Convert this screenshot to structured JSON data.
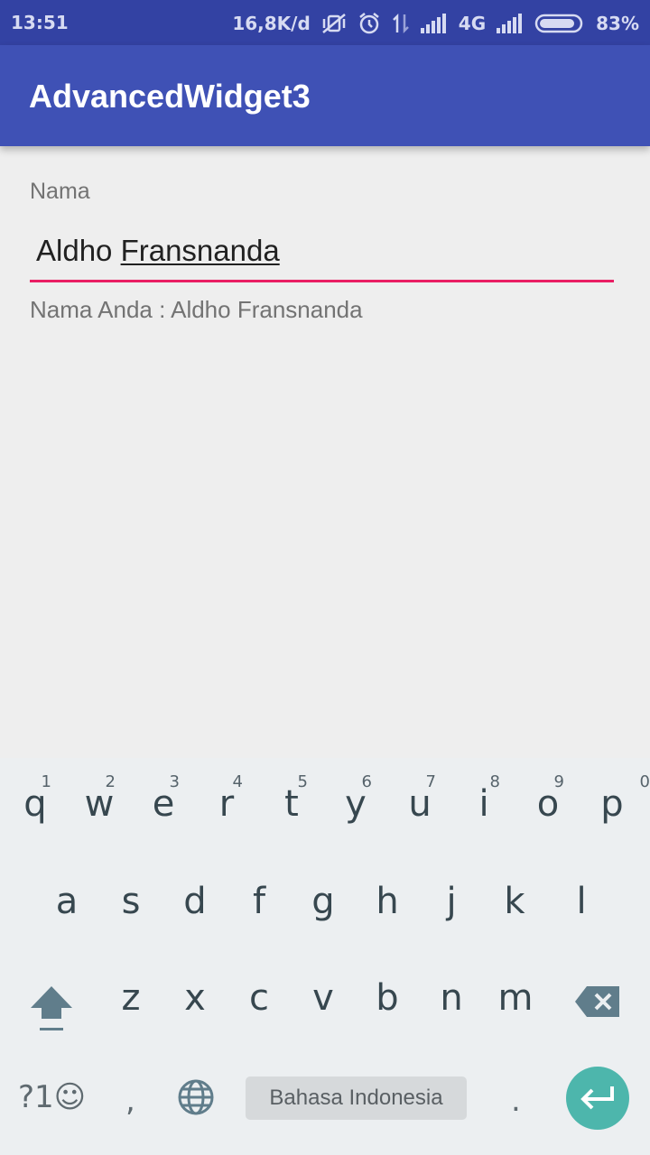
{
  "status_bar": {
    "time": "13:51",
    "speed": "16,8K/d",
    "network": "4G",
    "battery": "83%"
  },
  "app_bar": {
    "title": "AdvancedWidget3"
  },
  "form": {
    "label": "Nama",
    "input_first": "Aldho ",
    "input_second": "Fransnanda",
    "output": "Nama Anda : Aldho Fransnanda"
  },
  "keyboard": {
    "row1": [
      {
        "ch": "q",
        "hint": "1"
      },
      {
        "ch": "w",
        "hint": "2"
      },
      {
        "ch": "e",
        "hint": "3"
      },
      {
        "ch": "r",
        "hint": "4"
      },
      {
        "ch": "t",
        "hint": "5"
      },
      {
        "ch": "y",
        "hint": "6"
      },
      {
        "ch": "u",
        "hint": "7"
      },
      {
        "ch": "i",
        "hint": "8"
      },
      {
        "ch": "o",
        "hint": "9"
      },
      {
        "ch": "p",
        "hint": "0"
      }
    ],
    "row2": [
      "a",
      "s",
      "d",
      "f",
      "g",
      "h",
      "j",
      "k",
      "l"
    ],
    "row3": [
      "z",
      "x",
      "c",
      "v",
      "b",
      "n",
      "m"
    ],
    "symbols_key": "?1☺",
    "comma_key": ",",
    "period_key": ".",
    "space_label": "Bahasa Indonesia",
    "icons": {
      "shift": "shift-icon",
      "backspace": "backspace-icon",
      "globe": "globe-icon",
      "enter": "enter-icon"
    }
  },
  "colors": {
    "status_bar": "#3342a3",
    "app_bar": "#3f51b5",
    "accent": "#e91e63",
    "enter_key": "#4db6ac"
  }
}
